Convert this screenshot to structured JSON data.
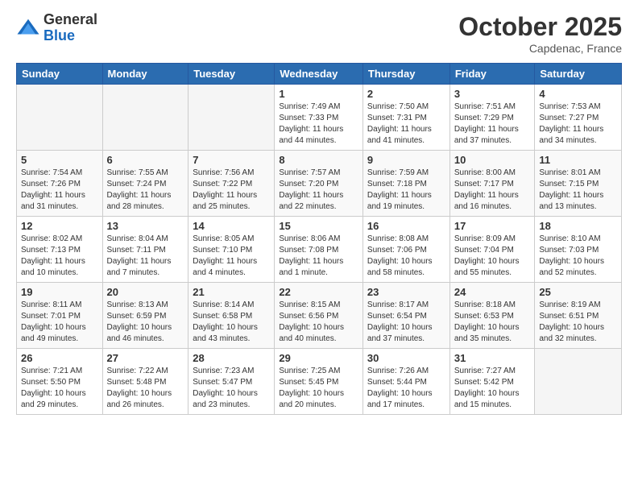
{
  "header": {
    "logo": {
      "general": "General",
      "blue": "Blue"
    },
    "title": "October 2025",
    "location": "Capdenac, France"
  },
  "calendar": {
    "headers": [
      "Sunday",
      "Monday",
      "Tuesday",
      "Wednesday",
      "Thursday",
      "Friday",
      "Saturday"
    ],
    "weeks": [
      [
        {
          "day": "",
          "sunrise": "",
          "sunset": "",
          "daylight": ""
        },
        {
          "day": "",
          "sunrise": "",
          "sunset": "",
          "daylight": ""
        },
        {
          "day": "",
          "sunrise": "",
          "sunset": "",
          "daylight": ""
        },
        {
          "day": "1",
          "sunrise": "Sunrise: 7:49 AM",
          "sunset": "Sunset: 7:33 PM",
          "daylight": "Daylight: 11 hours and 44 minutes."
        },
        {
          "day": "2",
          "sunrise": "Sunrise: 7:50 AM",
          "sunset": "Sunset: 7:31 PM",
          "daylight": "Daylight: 11 hours and 41 minutes."
        },
        {
          "day": "3",
          "sunrise": "Sunrise: 7:51 AM",
          "sunset": "Sunset: 7:29 PM",
          "daylight": "Daylight: 11 hours and 37 minutes."
        },
        {
          "day": "4",
          "sunrise": "Sunrise: 7:53 AM",
          "sunset": "Sunset: 7:27 PM",
          "daylight": "Daylight: 11 hours and 34 minutes."
        }
      ],
      [
        {
          "day": "5",
          "sunrise": "Sunrise: 7:54 AM",
          "sunset": "Sunset: 7:26 PM",
          "daylight": "Daylight: 11 hours and 31 minutes."
        },
        {
          "day": "6",
          "sunrise": "Sunrise: 7:55 AM",
          "sunset": "Sunset: 7:24 PM",
          "daylight": "Daylight: 11 hours and 28 minutes."
        },
        {
          "day": "7",
          "sunrise": "Sunrise: 7:56 AM",
          "sunset": "Sunset: 7:22 PM",
          "daylight": "Daylight: 11 hours and 25 minutes."
        },
        {
          "day": "8",
          "sunrise": "Sunrise: 7:57 AM",
          "sunset": "Sunset: 7:20 PM",
          "daylight": "Daylight: 11 hours and 22 minutes."
        },
        {
          "day": "9",
          "sunrise": "Sunrise: 7:59 AM",
          "sunset": "Sunset: 7:18 PM",
          "daylight": "Daylight: 11 hours and 19 minutes."
        },
        {
          "day": "10",
          "sunrise": "Sunrise: 8:00 AM",
          "sunset": "Sunset: 7:17 PM",
          "daylight": "Daylight: 11 hours and 16 minutes."
        },
        {
          "day": "11",
          "sunrise": "Sunrise: 8:01 AM",
          "sunset": "Sunset: 7:15 PM",
          "daylight": "Daylight: 11 hours and 13 minutes."
        }
      ],
      [
        {
          "day": "12",
          "sunrise": "Sunrise: 8:02 AM",
          "sunset": "Sunset: 7:13 PM",
          "daylight": "Daylight: 11 hours and 10 minutes."
        },
        {
          "day": "13",
          "sunrise": "Sunrise: 8:04 AM",
          "sunset": "Sunset: 7:11 PM",
          "daylight": "Daylight: 11 hours and 7 minutes."
        },
        {
          "day": "14",
          "sunrise": "Sunrise: 8:05 AM",
          "sunset": "Sunset: 7:10 PM",
          "daylight": "Daylight: 11 hours and 4 minutes."
        },
        {
          "day": "15",
          "sunrise": "Sunrise: 8:06 AM",
          "sunset": "Sunset: 7:08 PM",
          "daylight": "Daylight: 11 hours and 1 minute."
        },
        {
          "day": "16",
          "sunrise": "Sunrise: 8:08 AM",
          "sunset": "Sunset: 7:06 PM",
          "daylight": "Daylight: 10 hours and 58 minutes."
        },
        {
          "day": "17",
          "sunrise": "Sunrise: 8:09 AM",
          "sunset": "Sunset: 7:04 PM",
          "daylight": "Daylight: 10 hours and 55 minutes."
        },
        {
          "day": "18",
          "sunrise": "Sunrise: 8:10 AM",
          "sunset": "Sunset: 7:03 PM",
          "daylight": "Daylight: 10 hours and 52 minutes."
        }
      ],
      [
        {
          "day": "19",
          "sunrise": "Sunrise: 8:11 AM",
          "sunset": "Sunset: 7:01 PM",
          "daylight": "Daylight: 10 hours and 49 minutes."
        },
        {
          "day": "20",
          "sunrise": "Sunrise: 8:13 AM",
          "sunset": "Sunset: 6:59 PM",
          "daylight": "Daylight: 10 hours and 46 minutes."
        },
        {
          "day": "21",
          "sunrise": "Sunrise: 8:14 AM",
          "sunset": "Sunset: 6:58 PM",
          "daylight": "Daylight: 10 hours and 43 minutes."
        },
        {
          "day": "22",
          "sunrise": "Sunrise: 8:15 AM",
          "sunset": "Sunset: 6:56 PM",
          "daylight": "Daylight: 10 hours and 40 minutes."
        },
        {
          "day": "23",
          "sunrise": "Sunrise: 8:17 AM",
          "sunset": "Sunset: 6:54 PM",
          "daylight": "Daylight: 10 hours and 37 minutes."
        },
        {
          "day": "24",
          "sunrise": "Sunrise: 8:18 AM",
          "sunset": "Sunset: 6:53 PM",
          "daylight": "Daylight: 10 hours and 35 minutes."
        },
        {
          "day": "25",
          "sunrise": "Sunrise: 8:19 AM",
          "sunset": "Sunset: 6:51 PM",
          "daylight": "Daylight: 10 hours and 32 minutes."
        }
      ],
      [
        {
          "day": "26",
          "sunrise": "Sunrise: 7:21 AM",
          "sunset": "Sunset: 5:50 PM",
          "daylight": "Daylight: 10 hours and 29 minutes."
        },
        {
          "day": "27",
          "sunrise": "Sunrise: 7:22 AM",
          "sunset": "Sunset: 5:48 PM",
          "daylight": "Daylight: 10 hours and 26 minutes."
        },
        {
          "day": "28",
          "sunrise": "Sunrise: 7:23 AM",
          "sunset": "Sunset: 5:47 PM",
          "daylight": "Daylight: 10 hours and 23 minutes."
        },
        {
          "day": "29",
          "sunrise": "Sunrise: 7:25 AM",
          "sunset": "Sunset: 5:45 PM",
          "daylight": "Daylight: 10 hours and 20 minutes."
        },
        {
          "day": "30",
          "sunrise": "Sunrise: 7:26 AM",
          "sunset": "Sunset: 5:44 PM",
          "daylight": "Daylight: 10 hours and 17 minutes."
        },
        {
          "day": "31",
          "sunrise": "Sunrise: 7:27 AM",
          "sunset": "Sunset: 5:42 PM",
          "daylight": "Daylight: 10 hours and 15 minutes."
        },
        {
          "day": "",
          "sunrise": "",
          "sunset": "",
          "daylight": ""
        }
      ]
    ]
  }
}
